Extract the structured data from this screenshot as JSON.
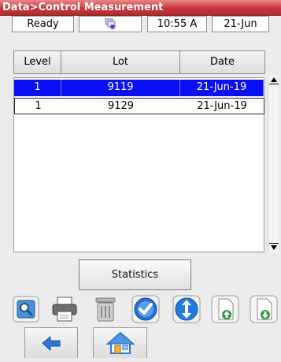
{
  "title": "Data>Control Measurement",
  "status": {
    "state": "Ready",
    "time": "10:55 A",
    "date": "21-Jun"
  },
  "table": {
    "headers": [
      "Level",
      "Lot",
      "Date"
    ],
    "rows": [
      {
        "level": "1",
        "lot": "9119",
        "date": "21-Jun-19",
        "selected": true
      },
      {
        "level": "1",
        "lot": "9129",
        "date": "21-Jun-19",
        "selected": false
      }
    ]
  },
  "buttons": {
    "statistics": "Statistics"
  },
  "toolbar": {
    "icons": [
      "search-icon",
      "print-icon",
      "trash-icon",
      "checkmark-icon",
      "up-down-icon",
      "upload-file-icon",
      "download-file-icon"
    ]
  },
  "nav": {
    "icons": [
      "back-arrow-icon",
      "home-icon"
    ]
  },
  "colors": {
    "titlebar": "#c8383d",
    "selected_row": "#0a10f5"
  }
}
